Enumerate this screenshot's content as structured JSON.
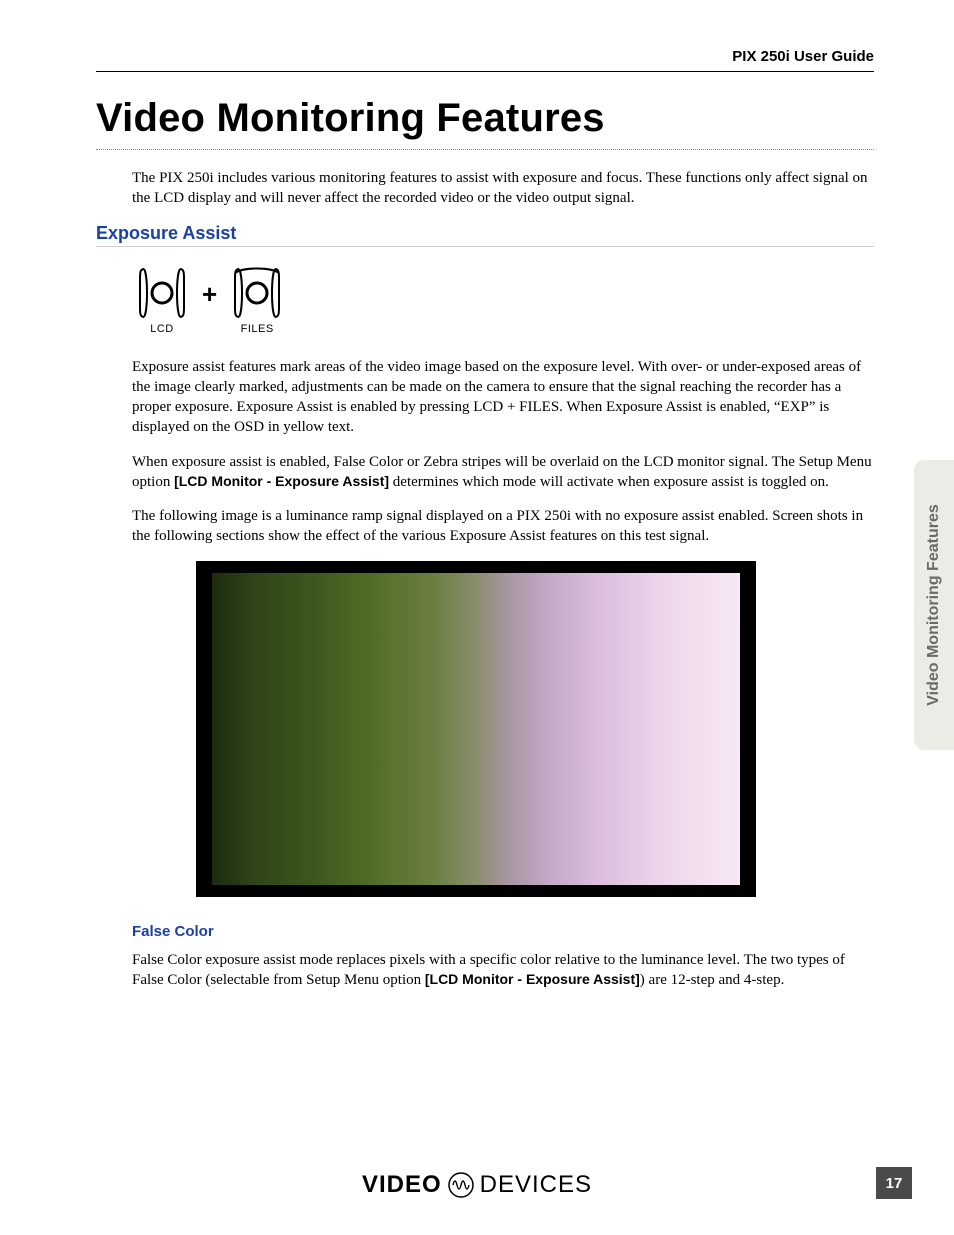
{
  "header": {
    "guide_title": "PIX 250i User Guide"
  },
  "page": {
    "title": "Video Monitoring Features",
    "intro": "The PIX 250i includes various monitoring features to assist with exposure and focus. These functions only affect signal on the LCD display and will never affect the recorded video or the video output signal.",
    "side_tab": "Video Monitoring Features",
    "number": "17"
  },
  "exposure_assist": {
    "heading": "Exposure Assist",
    "icon_lcd_label": "LCD",
    "icon_plus": "+",
    "icon_files_label": "FILES",
    "para1": "Exposure assist features mark areas of the video image based on the exposure level. With over- or under-exposed areas of the image clearly marked, adjustments can be made on the camera to ensure that the signal reaching the recorder has a proper exposure. Exposure Assist is enabled by pressing LCD + FILES. When Exposure Assist is enabled, “EXP” is displayed on the OSD in yellow text.",
    "para2_a": "When exposure assist is enabled, False Color or Zebra stripes will be overlaid on the LCD monitor signal. The Setup Menu option ",
    "para2_menu": "[LCD Monitor - Exposure Assist]",
    "para2_b": " determines which mode will activate when exposure assist is toggled on.",
    "para3": "The following image is a luminance ramp signal displayed on a PIX 250i with no exposure assist enabled. Screen shots in the following sections show the effect of the various Exposure Assist features on this test signal."
  },
  "false_color": {
    "heading": "False Color",
    "para_a": "False Color exposure assist mode replaces pixels with a specific color relative to the luminance level. The two types of False Color (selectable from Setup Menu option ",
    "para_menu": "[LCD Monitor - Exposure Assist]",
    "para_b": ") are 12-step and 4-step."
  },
  "footer": {
    "brand_left": "VIDEO",
    "brand_right": "DEVICES"
  }
}
